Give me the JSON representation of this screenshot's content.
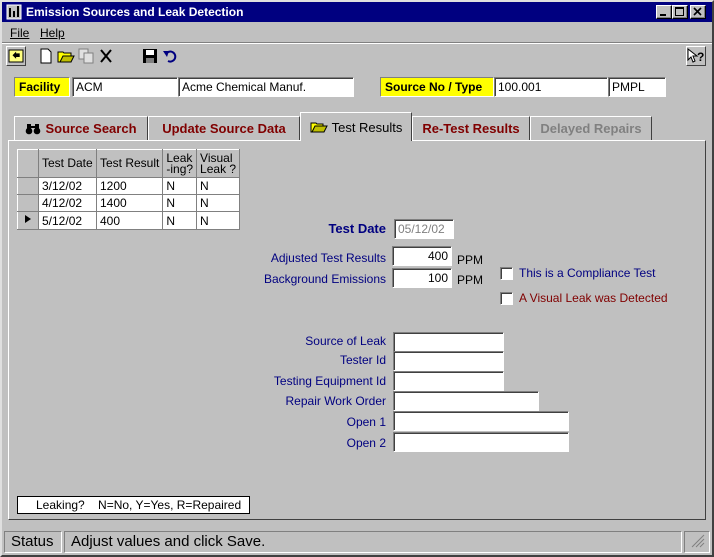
{
  "window": {
    "title": "Emission Sources and Leak Detection"
  },
  "menu": {
    "file": "File",
    "help": "Help"
  },
  "toolbar": {
    "icons": [
      "exit-icon",
      "new-icon",
      "open-icon",
      "copy-icon",
      "delete-icon",
      "save-icon",
      "undo-icon",
      "context-help-icon"
    ]
  },
  "header": {
    "facility_label": "Facility",
    "facility_code": "ACM",
    "facility_name": "Acme Chemical Manuf.",
    "source_label": "Source No / Type",
    "source_no": "100.001",
    "source_type": "PMPL"
  },
  "tabs": [
    {
      "label": "Source Search"
    },
    {
      "label": "Update Source Data"
    },
    {
      "label": "Test Results"
    },
    {
      "label": "Re-Test Results"
    },
    {
      "label": "Delayed Repairs"
    }
  ],
  "grid": {
    "headers": [
      "Test Date",
      "Test Result",
      "Leak\n-ing?",
      "Visual\nLeak ?"
    ],
    "rows": [
      {
        "date": "3/12/02",
        "result": "1200",
        "leaking": "N",
        "visual": "N"
      },
      {
        "date": "4/12/02",
        "result": "1400",
        "leaking": "N",
        "visual": "N"
      },
      {
        "date": "5/12/02",
        "result": "400",
        "leaking": "N",
        "visual": "N"
      }
    ]
  },
  "form": {
    "test_date_label": "Test Date",
    "test_date_value": "05/12/02",
    "adjusted_label": "Adjusted Test Results",
    "adjusted_value": "400",
    "adjusted_unit": "PPM",
    "background_label": "Background Emissions",
    "background_value": "100",
    "background_unit": "PPM",
    "compliance_label": "This is a Compliance Test",
    "visual_leak_label": "A Visual Leak was Detected",
    "source_of_leak_label": "Source of Leak",
    "tester_id_label": "Tester Id",
    "equipment_label": "Testing Equipment Id",
    "work_order_label": "Repair Work Order",
    "open1_label": "Open 1",
    "open2_label": "Open 2"
  },
  "legend": {
    "text": "Leaking?    N=No, Y=Yes, R=Repaired"
  },
  "status": {
    "label": "Status",
    "message": "Adjust values and click Save."
  },
  "colors": {
    "title_bar": "#000080",
    "highlight_label": "#ffff00",
    "tab_text": "#800000",
    "form_label": "#000080"
  }
}
